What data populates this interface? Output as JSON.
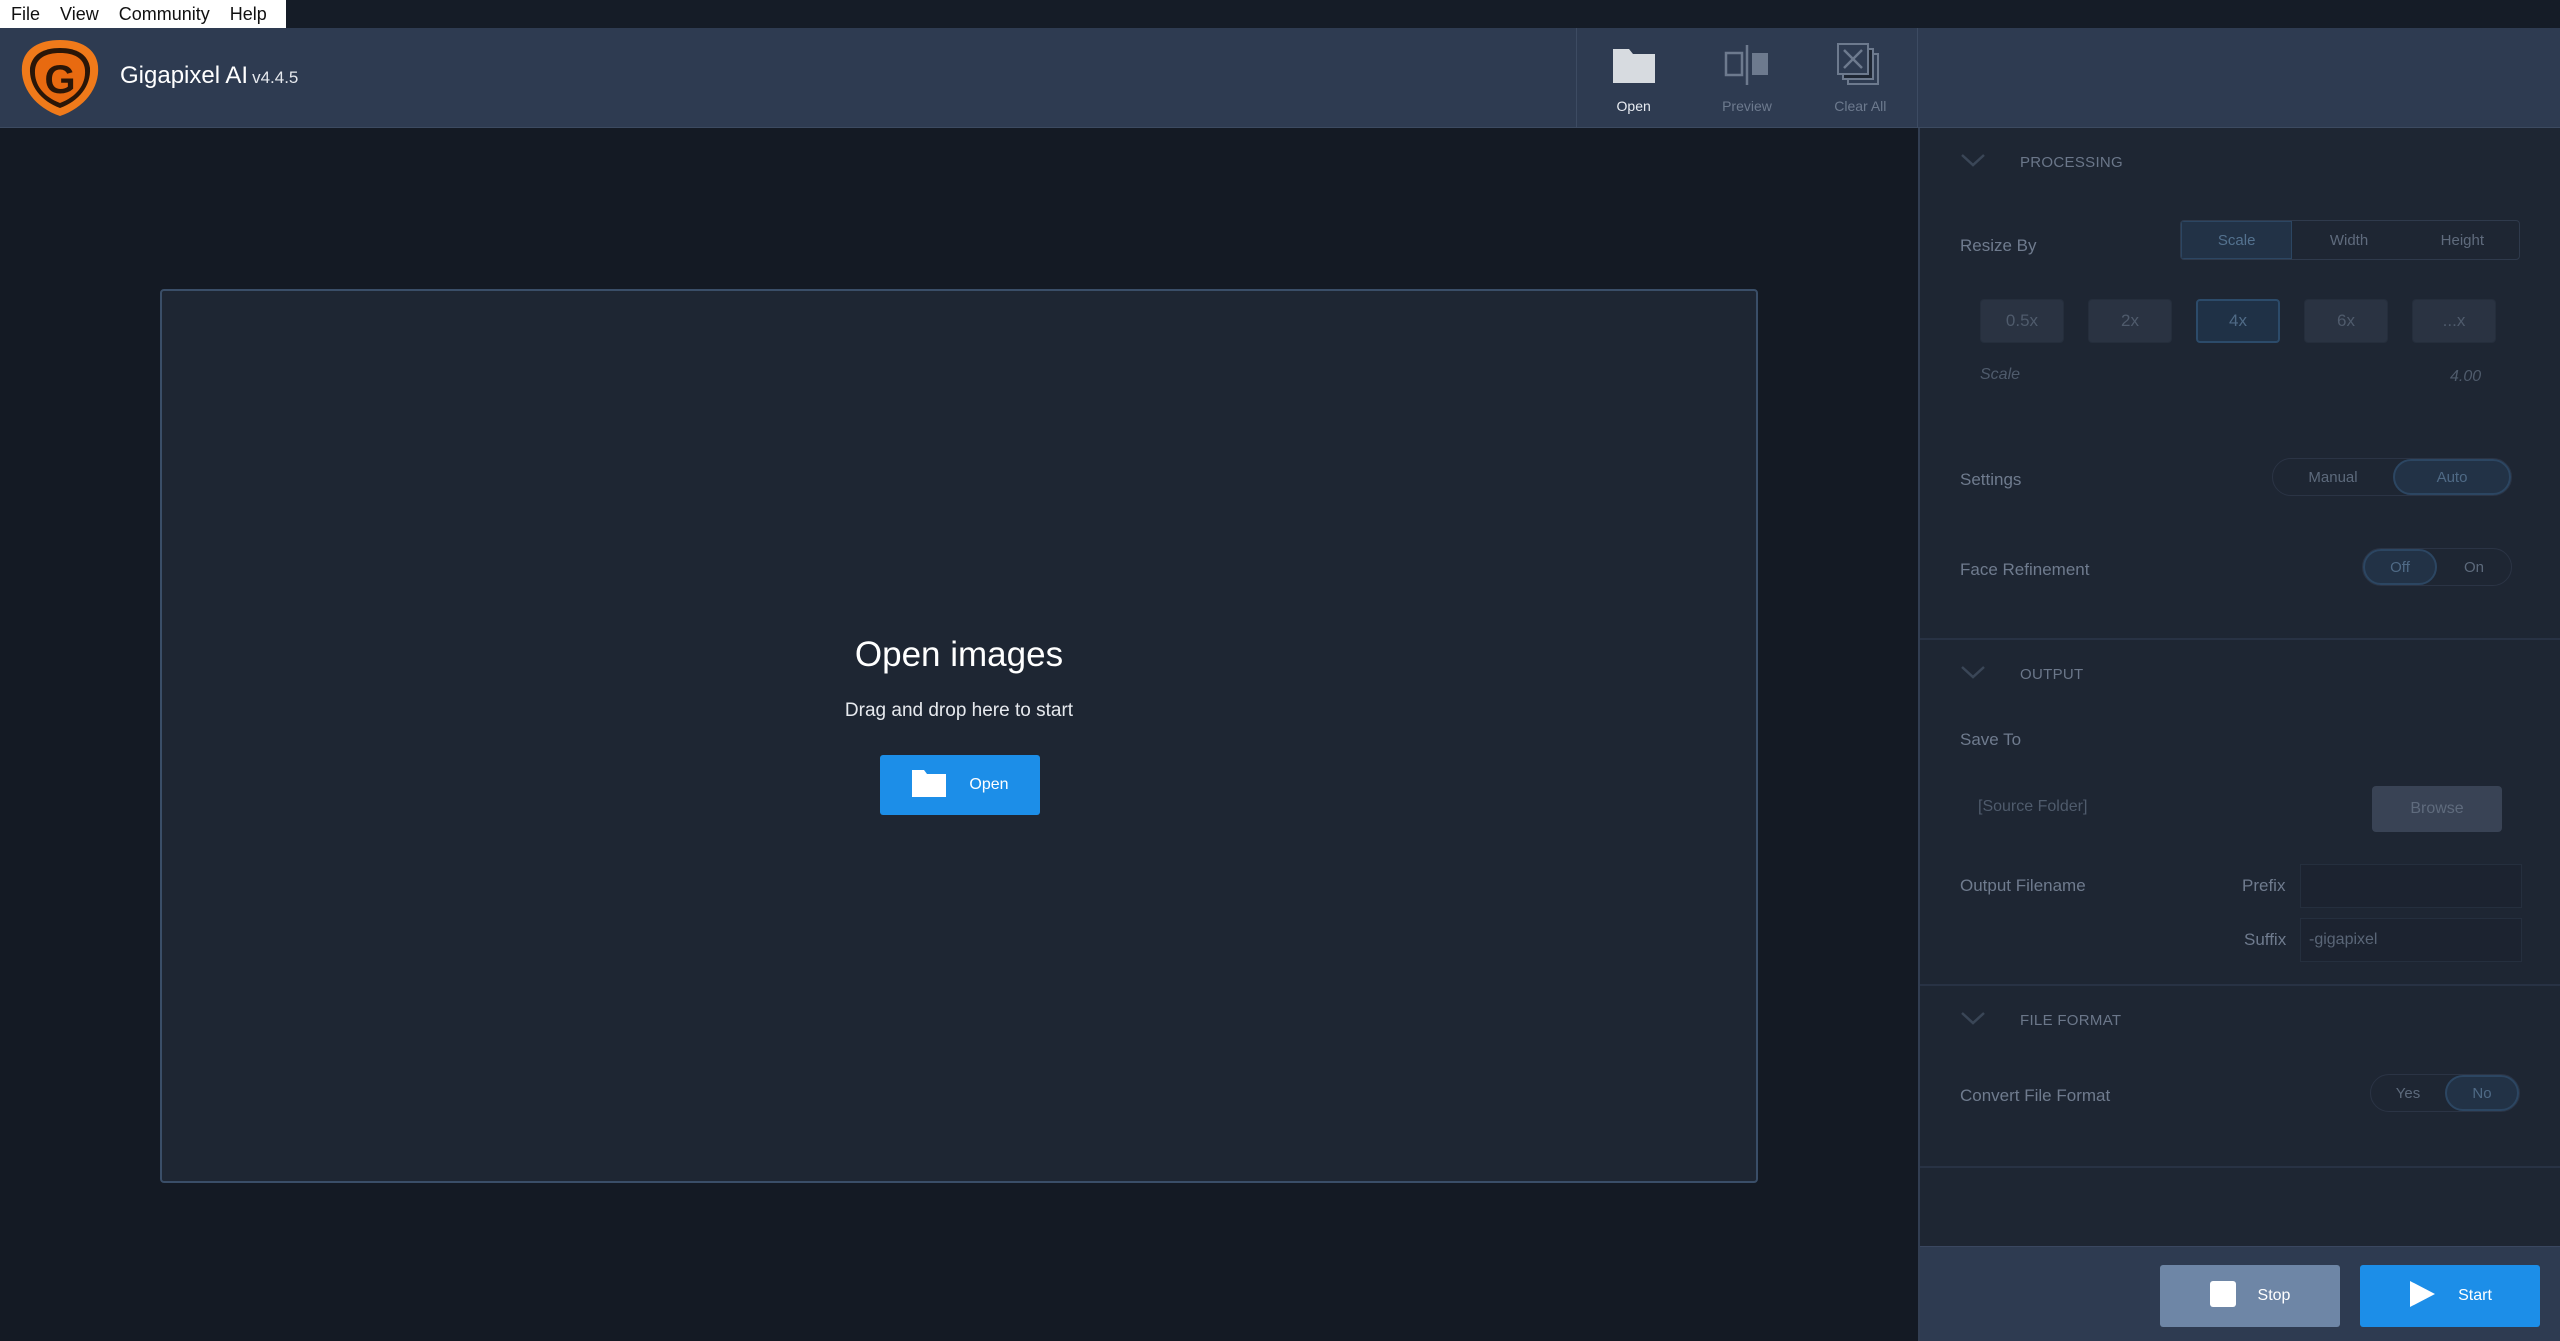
{
  "menu": {
    "items": [
      "File",
      "View",
      "Community",
      "Help"
    ]
  },
  "header": {
    "app_name": "Gigapixel AI",
    "version": "v4.4.5",
    "logo_letter": "G",
    "toolbar": {
      "open_label": "Open",
      "preview_label": "Preview",
      "clear_all_label": "Clear All"
    }
  },
  "main": {
    "title": "Open images",
    "subtitle": "Drag and drop here to start",
    "open_button_label": "Open"
  },
  "panel": {
    "processing": {
      "title": "PROCESSING",
      "resize_by_label": "Resize By",
      "resize_options": [
        "Scale",
        "Width",
        "Height"
      ],
      "resize_selected": "Scale",
      "scale_buttons": [
        "0.5x",
        "2x",
        "4x",
        "6x",
        "...x"
      ],
      "scale_selected": "4x",
      "scale_label": "Scale",
      "scale_value": "4.00",
      "settings_label": "Settings",
      "settings_options": [
        "Manual",
        "Auto"
      ],
      "settings_selected": "Auto",
      "face_label": "Face Refinement",
      "face_options": [
        "Off",
        "On"
      ],
      "face_selected": "Off"
    },
    "output": {
      "title": "OUTPUT",
      "save_to_label": "Save To",
      "save_to_value": "[Source Folder]",
      "browse_label": "Browse",
      "filename_label": "Output Filename",
      "prefix_label": "Prefix",
      "prefix_value": "",
      "suffix_label": "Suffix",
      "suffix_value": "-gigapixel"
    },
    "file_format": {
      "title": "FILE FORMAT",
      "convert_label": "Convert File Format",
      "convert_options": [
        "Yes",
        "No"
      ],
      "convert_selected": "No"
    },
    "actions": {
      "stop_label": "Stop",
      "start_label": "Start"
    }
  },
  "colors": {
    "accent": "#1c8ee8",
    "header_bg": "#2e3b51",
    "panel_bg": "#1e2633",
    "main_bg": "#141a24",
    "logo_orange": "#f07a1a"
  }
}
